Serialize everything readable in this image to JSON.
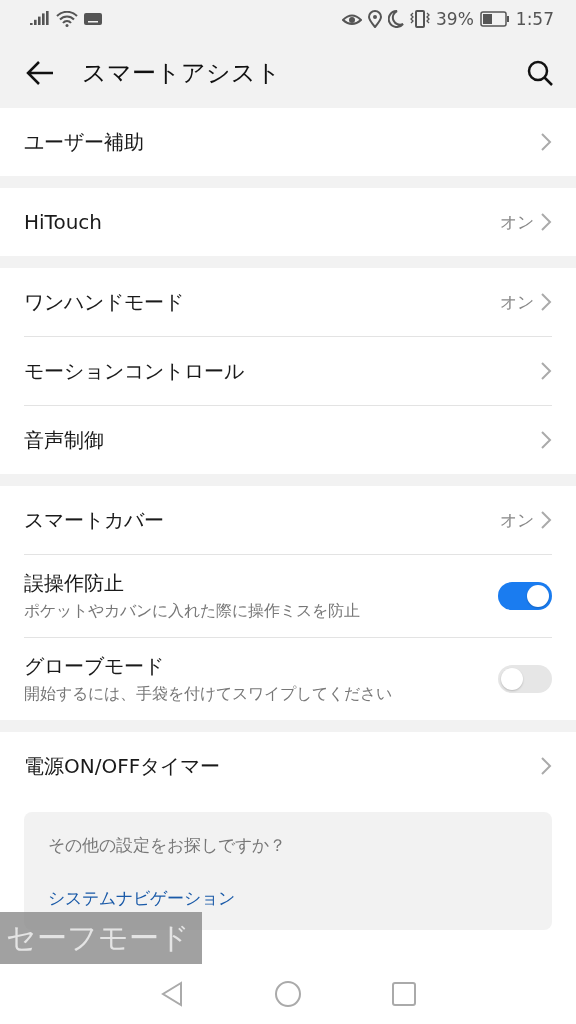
{
  "status_bar": {
    "battery": "39%",
    "time": "1:57"
  },
  "header": {
    "title": "スマートアシスト"
  },
  "sections": [
    {
      "rows": [
        {
          "kind": "link",
          "label": "ユーザー補助"
        }
      ]
    },
    {
      "rows": [
        {
          "kind": "link",
          "label": "HiTouch",
          "value": "オン"
        }
      ]
    },
    {
      "rows": [
        {
          "kind": "link",
          "label": "ワンハンドモード",
          "value": "オン"
        },
        {
          "kind": "link",
          "label": "モーションコントロール"
        },
        {
          "kind": "link",
          "label": "音声制御"
        }
      ]
    },
    {
      "rows": [
        {
          "kind": "link",
          "label": "スマートカバー",
          "value": "オン"
        },
        {
          "kind": "toggle",
          "label": "誤操作防止",
          "subtitle": "ポケットやカバンに入れた際に操作ミスを防止",
          "on": true
        },
        {
          "kind": "toggle",
          "label": "グローブモード",
          "subtitle": "開始するには、手袋を付けてスワイプしてください",
          "on": false
        }
      ]
    },
    {
      "rows": [
        {
          "kind": "link",
          "label": "電源ON/OFFタイマー"
        }
      ]
    }
  ],
  "suggestion": {
    "question": "その他の設定をお探しですか？",
    "link": "システムナビゲーション"
  },
  "safe_mode": "セーフモード"
}
